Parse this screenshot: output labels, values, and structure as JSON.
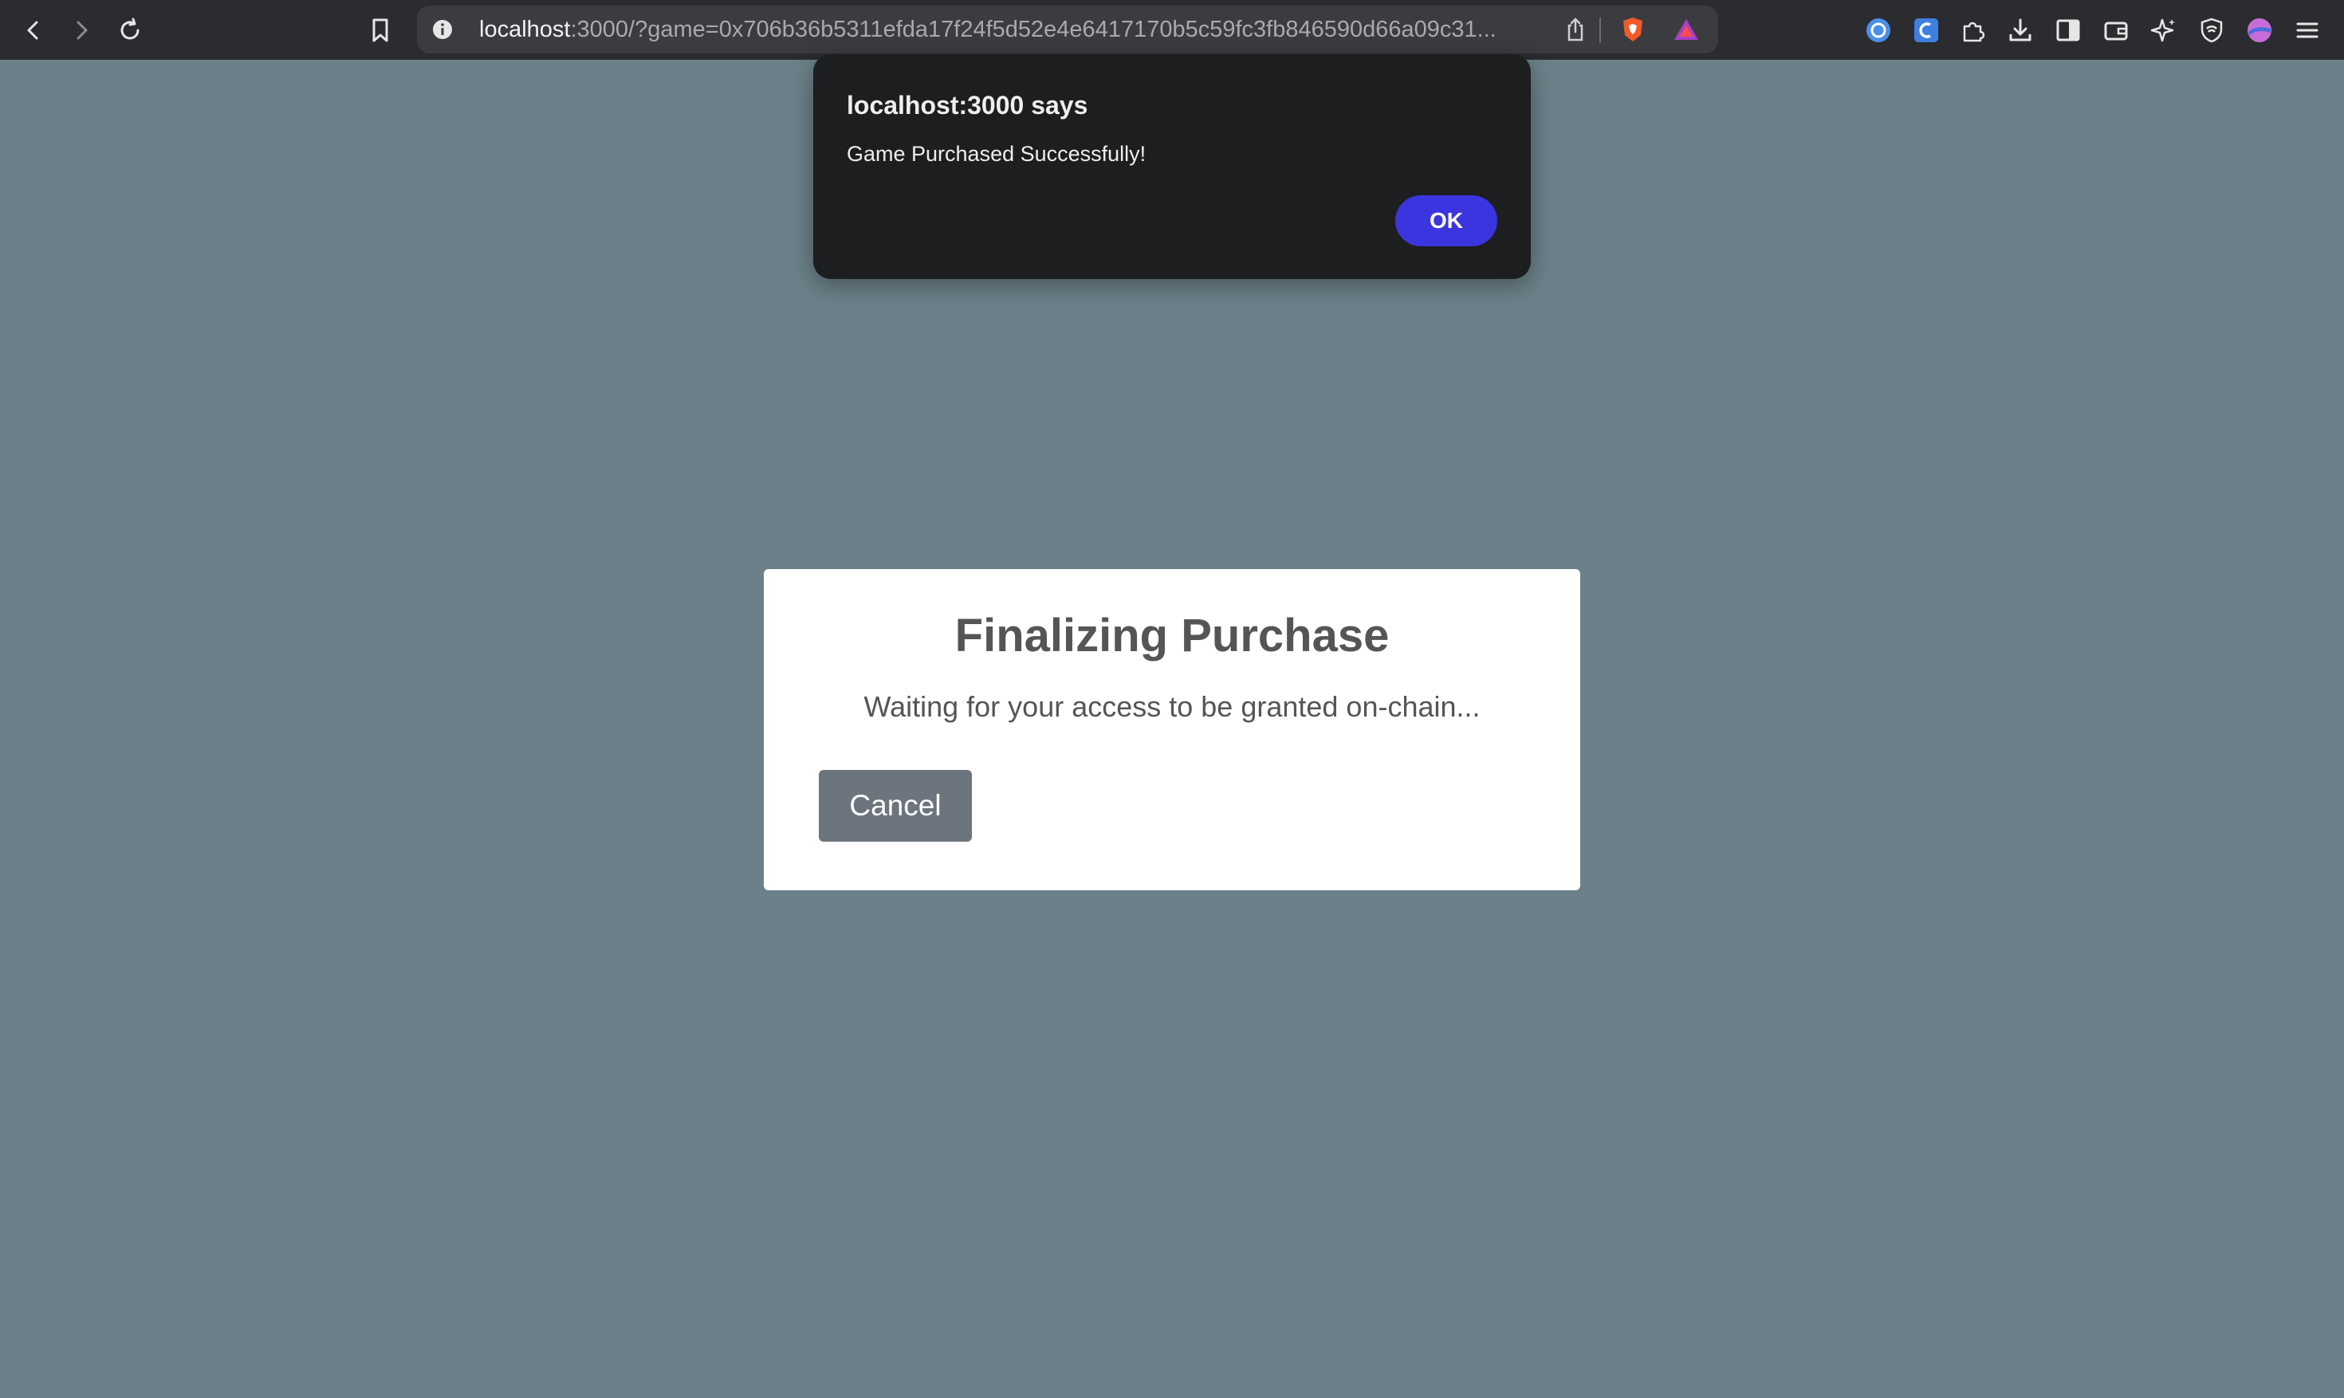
{
  "browser": {
    "url_host": "localhost",
    "url_rest": ":3000/?game=0x706b36b5311efda17f24f5d52e4e6417170b5c59fc3fb846590d66a09c31...",
    "icons": [
      "back-icon",
      "forward-icon",
      "reload-icon",
      "bookmark-icon",
      "site-info-icon",
      "share-icon",
      "brave-shields-icon",
      "brave-rewards-icon",
      "extension-1-icon",
      "extension-2-icon",
      "extensions-icon",
      "downloads-icon",
      "sidebar-icon",
      "wallet-icon",
      "leo-ai-icon",
      "vpn-icon",
      "profile-icon",
      "menu-icon"
    ]
  },
  "alert": {
    "title": "localhost:3000 says",
    "message": "Game Purchased Successfully!",
    "ok_label": "OK"
  },
  "dialog": {
    "title": "Finalizing Purchase",
    "message": "Waiting for your access to be granted on-chain...",
    "cancel_label": "Cancel"
  },
  "colors": {
    "page_background": "#6b8088",
    "ok_button": "#3b35e0",
    "cancel_button": "#6c757d"
  }
}
